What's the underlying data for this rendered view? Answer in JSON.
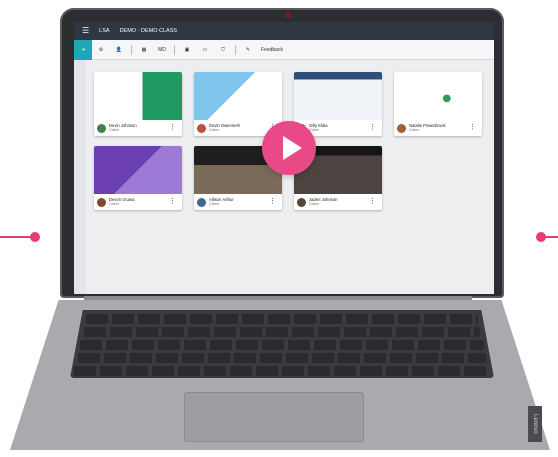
{
  "app": {
    "title_org": "LSA",
    "title_class": "DEMO · DEMO CLASS"
  },
  "toolbar": {
    "md_label": "MD",
    "feedback_label": "Feedback"
  },
  "students": [
    {
      "name": "Devin Johnson",
      "status": "Online"
    },
    {
      "name": "Devin Gwenneth",
      "status": "Online"
    },
    {
      "name": "Gilly Eldia",
      "status": "Online"
    },
    {
      "name": "Natalie Powerbrook",
      "status": "Online"
    },
    {
      "name": "Devon Ocana",
      "status": "Online"
    },
    {
      "name": "Allison Arthur",
      "status": "Online"
    },
    {
      "name": "Jaden Johnson",
      "status": "Online"
    }
  ],
  "device": {
    "brand": "Lenovo"
  },
  "colors": {
    "accent": "#1fa7b8",
    "play": "#e94a87",
    "side_line": "#e23c7e"
  }
}
